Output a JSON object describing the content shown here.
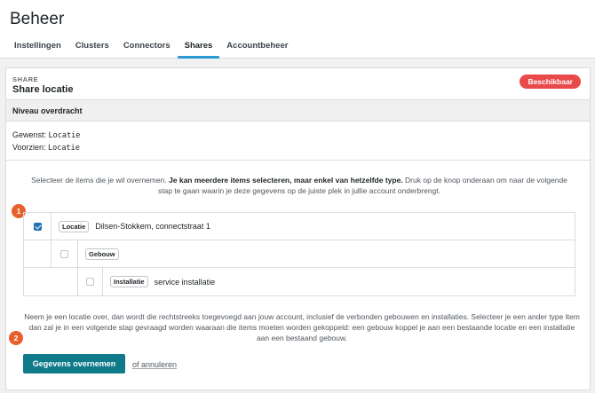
{
  "app": {
    "title": "Beheer"
  },
  "tabs": [
    {
      "label": "Instellingen"
    },
    {
      "label": "Clusters"
    },
    {
      "label": "Connectors"
    },
    {
      "label": "Shares"
    },
    {
      "label": "Accountbeheer"
    }
  ],
  "active_tab": "Shares",
  "share": {
    "eyebrow": "SHARE",
    "title": "Share locatie",
    "status_badge": "Beschikbaar",
    "status_color": "#e84a4a"
  },
  "transfer": {
    "section_title": "Niveau overdracht",
    "wanted_label": "Gewenst:",
    "wanted_value": "Locatie",
    "provided_label": "Voorzien:",
    "provided_value": "Locatie"
  },
  "instructions": {
    "part1": "Selecteer de items die je wil overnemen. ",
    "bold": "Je kan meerdere items selecteren, maar enkel van hetzelfde type.",
    "part2": " Druk op de knop onderaan om naar de volgende stap te gaan waarin je deze gegevens op de juiste plek in jullie account onderbrengt."
  },
  "tree": [
    {
      "type": "Locatie",
      "name": "Dilsen-Stokkem, connectstraat 1",
      "checked": true
    },
    {
      "type": "Gebouw",
      "name": "",
      "checked": false
    },
    {
      "type": "Installatie",
      "name": "service installatie",
      "checked": false
    }
  ],
  "steps": {
    "step1": "1",
    "step2": "2"
  },
  "footnote": "Neem je een locatie over, dan wordt die rechtstreeks toegevoegd aan jouw account, inclusief de verbonden gebouwen en installaties. Selecteer je een ander type item dan zal je in een volgende stap gevraagd worden waaraan die items moeten worden gekoppeld: een gebouw koppel je aan een bestaande locatie en een installatie aan een bestaand gebouw.",
  "actions": {
    "primary_label": "Gegevens overnemen",
    "cancel_label": "of annuleren"
  },
  "colors": {
    "accent": "#2c9bd6",
    "primary_button": "#0f7a8a",
    "step_marker": "#e8612c"
  }
}
